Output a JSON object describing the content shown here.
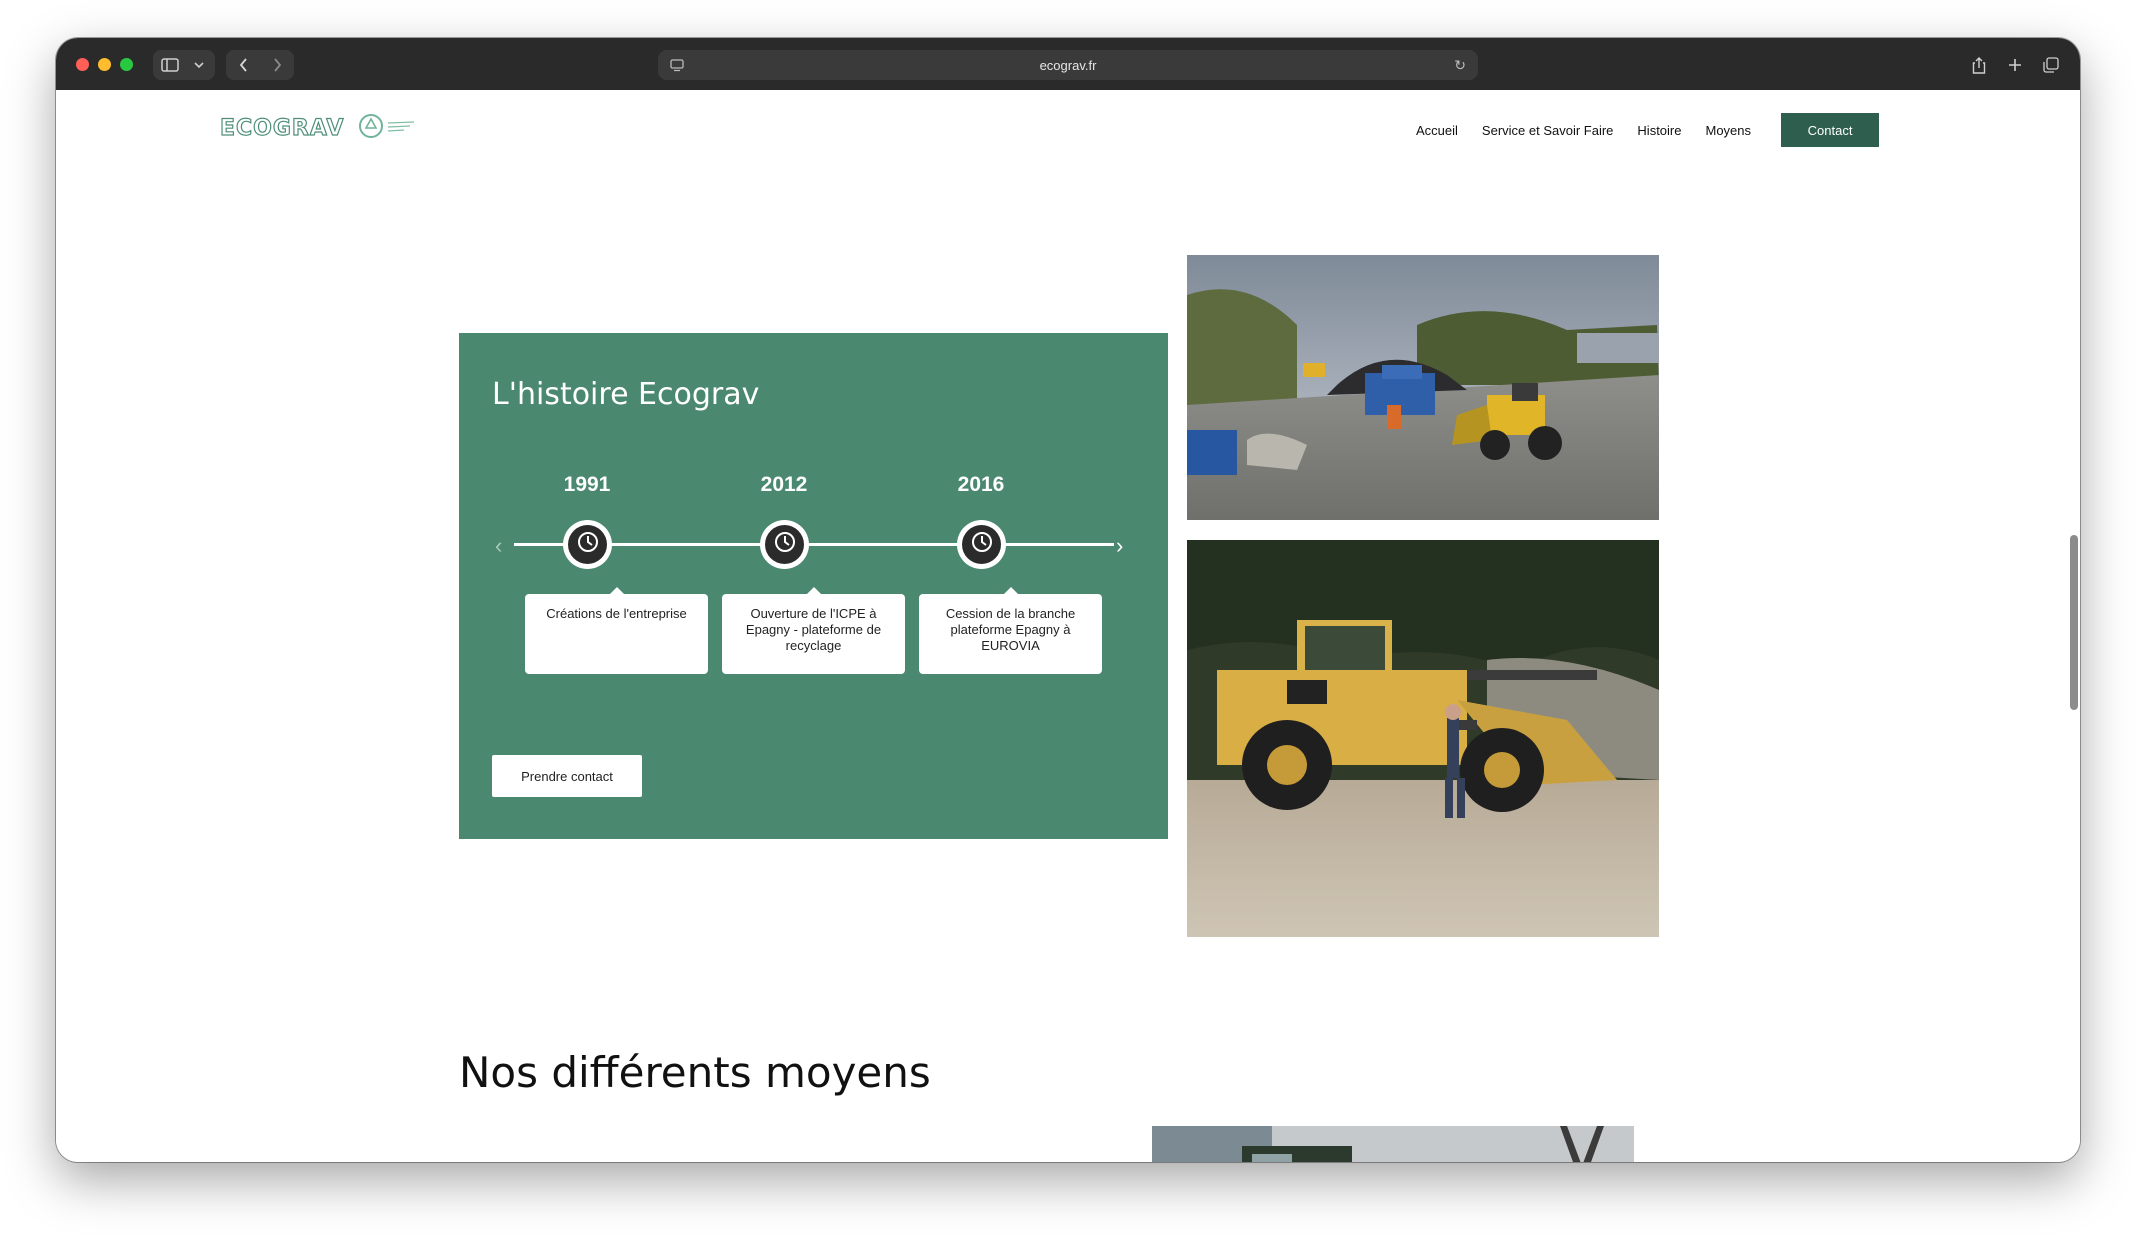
{
  "browser": {
    "url": "ecograv.fr",
    "icons": [
      "sidebar-icon",
      "chevron-down-icon",
      "back-icon",
      "forward-icon",
      "page-settings-icon",
      "reload-icon",
      "share-icon",
      "new-tab-icon",
      "tabs-overview-icon"
    ]
  },
  "site": {
    "logo_text": "ECOGRAV",
    "nav": {
      "items": [
        "Accueil",
        "Service et Savoir Faire",
        "Histoire",
        "Moyens"
      ],
      "contact_label": "Contact"
    },
    "history": {
      "title": "L'histoire Ecograv",
      "events": [
        {
          "year": "1991",
          "text": "Créations de l'entreprise"
        },
        {
          "year": "2012",
          "text": "Ouverture de l'ICPE à Epagny - plateforme de recyclage"
        },
        {
          "year": "2016",
          "text": "Cession de la branche plateforme Epagny à EUROVIA"
        }
      ],
      "cta_label": "Prendre contact"
    },
    "section_title": "Nos différents moyens",
    "photos": [
      "quarry-site-photo",
      "wheel-loader-photo",
      "machinery-photo"
    ]
  },
  "colors": {
    "brand_green": "#4b8870",
    "dark_green": "#2e5e4e"
  }
}
